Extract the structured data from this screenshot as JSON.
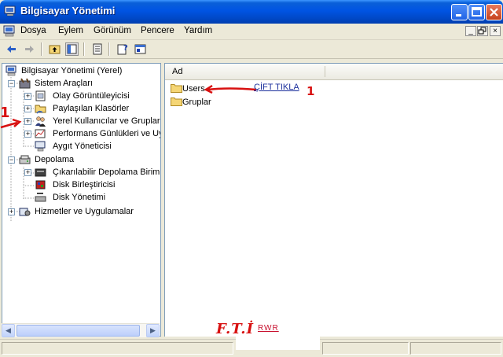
{
  "window": {
    "title": "Bilgisayar Yönetimi"
  },
  "menu": {
    "items": [
      "Dosya",
      "Eylem",
      "Görünüm",
      "Pencere",
      "Yardım"
    ]
  },
  "tree": {
    "root": "Bilgisayar Yönetimi (Yerel)",
    "items": [
      {
        "label": "Sistem Araçları",
        "icon": "tools-icon",
        "expanded": true
      },
      {
        "label": "Olay Görüntüleyicisi",
        "icon": "event-viewer-icon"
      },
      {
        "label": "Paylaşılan Klasörler",
        "icon": "shared-folder-icon"
      },
      {
        "label": "Yerel Kullanıcılar ve Gruplar",
        "icon": "users-icon",
        "selected": true
      },
      {
        "label": "Performans Günlükleri ve Uy",
        "icon": "performance-icon"
      },
      {
        "label": "Aygıt Yöneticisi",
        "icon": "device-manager-icon"
      },
      {
        "label": "Depolama",
        "icon": "storage-icon",
        "expanded": true
      },
      {
        "label": "Çıkarılabilir Depolama Birimi",
        "icon": "removable-storage-icon"
      },
      {
        "label": "Disk Birleştiricisi",
        "icon": "defrag-icon"
      },
      {
        "label": "Disk Yönetimi",
        "icon": "disk-management-icon"
      },
      {
        "label": "Hizmetler ve Uygulamalar",
        "icon": "services-icon"
      }
    ]
  },
  "list": {
    "column_header": "Ad",
    "items": [
      "Users",
      "Gruplar"
    ]
  },
  "annotations": {
    "instruction": "ÇİFT TIKLA",
    "step_right": "1",
    "step_left": "1",
    "signature": "F.T.İ",
    "watermark": "RWR"
  },
  "colors": {
    "title_bar": "#0054e3",
    "annotation_red": "#d81010",
    "link_blue": "#1b2f9c"
  }
}
